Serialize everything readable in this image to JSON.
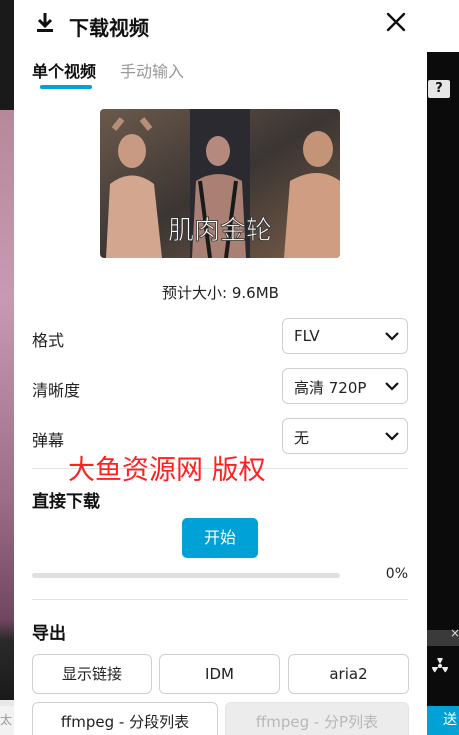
{
  "dialog": {
    "title": "下载视频",
    "tabs": [
      {
        "label": "单个视频",
        "active": true
      },
      {
        "label": "手动输入",
        "active": false
      }
    ],
    "thumbnail_caption": "肌肉金轮",
    "estimated_size": "预计大小: 9.6MB",
    "fields": [
      {
        "label": "格式",
        "value": "FLV"
      },
      {
        "label": "清晰度",
        "value": "高清 720P"
      },
      {
        "label": "弹幕",
        "value": "无"
      }
    ],
    "watermark": "大鱼资源网 版权",
    "direct_download": {
      "title": "直接下载",
      "start_label": "开始",
      "progress_percent": 0,
      "progress_label": "0%"
    },
    "export": {
      "title": "导出",
      "buttons": [
        {
          "label": "显示链接",
          "enabled": true
        },
        {
          "label": "IDM",
          "enabled": true
        },
        {
          "label": "aria2",
          "enabled": true
        },
        {
          "label": "ffmpeg - 分段列表",
          "enabled": true
        },
        {
          "label": "ffmpeg - 分P列表",
          "enabled": false
        }
      ]
    }
  },
  "background": {
    "help_badge": "?",
    "send_button": "送",
    "bottom_left_text": "太"
  },
  "colors": {
    "accent": "#00a1d6",
    "watermark": "#ff2020"
  },
  "icons": {
    "download": "download-icon",
    "close": "close-icon",
    "chevron": "chevron-down-icon",
    "radiation": "radiation-icon"
  }
}
